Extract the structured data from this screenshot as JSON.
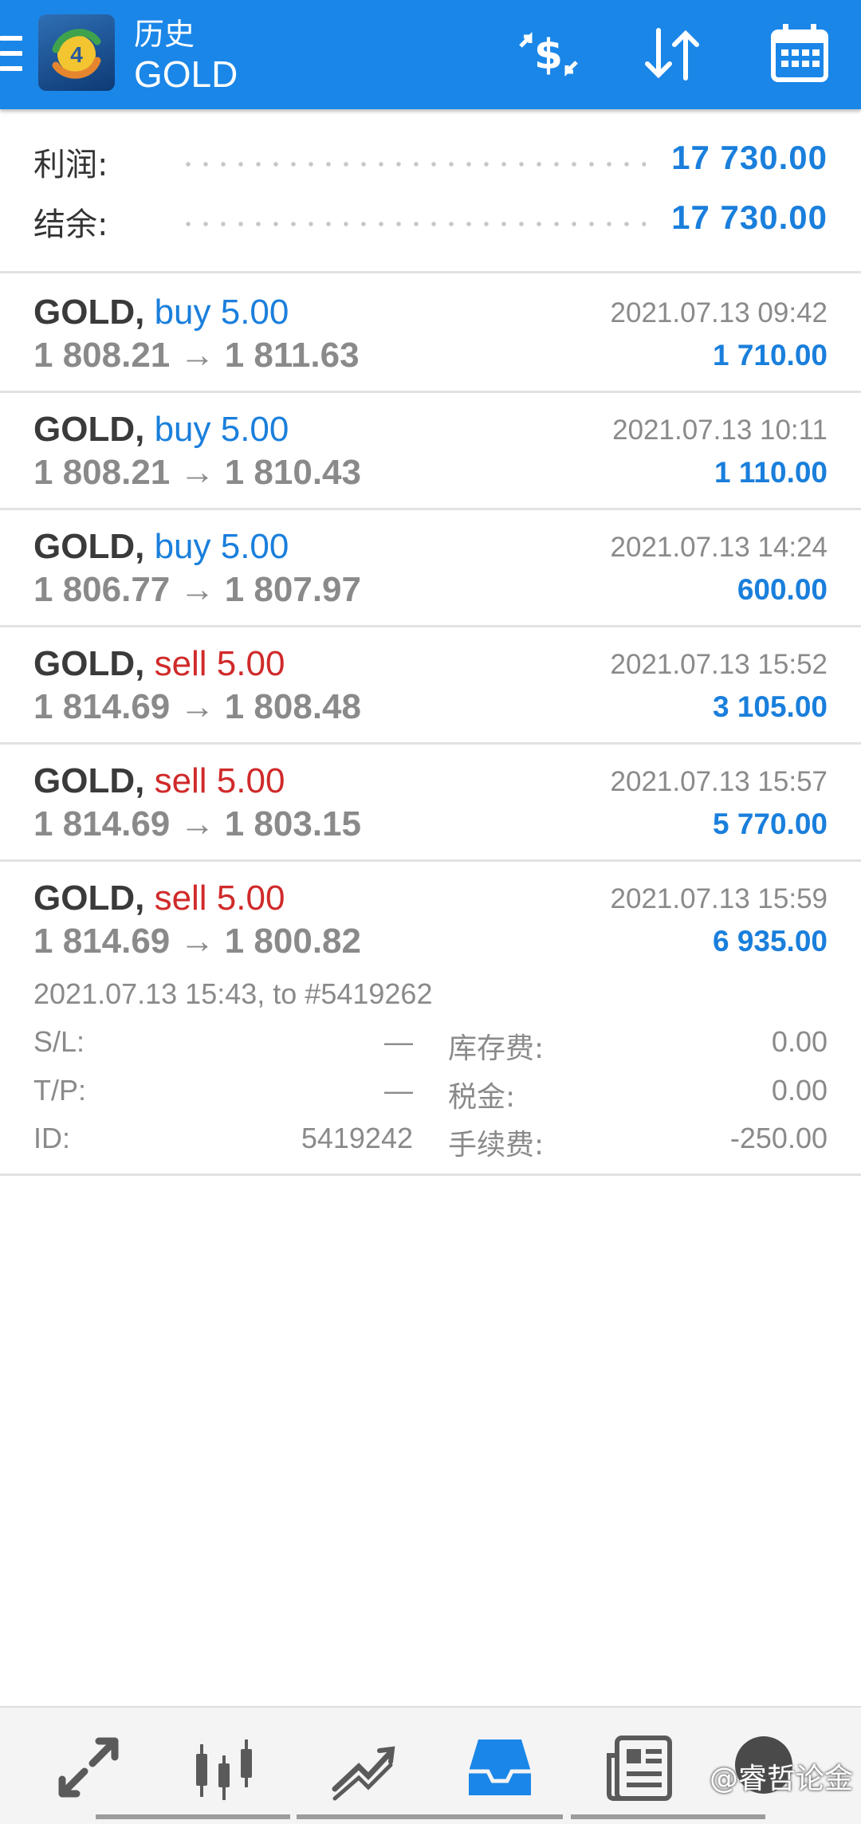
{
  "header": {
    "title": "历史",
    "subtitle": "GOLD",
    "icons": [
      "menu-icon",
      "metatrader-logo-icon",
      "currency-exchange-icon",
      "sort-icon",
      "calendar-icon"
    ]
  },
  "summary": {
    "profit_label": "利润:",
    "profit_value": "17 730.00",
    "balance_label": "结余:",
    "balance_value": "17 730.00"
  },
  "deals": [
    {
      "symbol": "GOLD,",
      "type": "buy 5.00",
      "direction": "buy",
      "prices": "1 808.21 → 1 811.63",
      "time": "2021.07.13 09:42",
      "profit": "1 710.00"
    },
    {
      "symbol": "GOLD,",
      "type": "buy 5.00",
      "direction": "buy",
      "prices": "1 808.21 → 1 810.43",
      "time": "2021.07.13 10:11",
      "profit": "1 110.00"
    },
    {
      "symbol": "GOLD,",
      "type": "buy 5.00",
      "direction": "buy",
      "prices": "1 806.77 → 1 807.97",
      "time": "2021.07.13 14:24",
      "profit": "600.00"
    },
    {
      "symbol": "GOLD,",
      "type": "sell 5.00",
      "direction": "sell",
      "prices": "1 814.69 → 1 808.48",
      "time": "2021.07.13 15:52",
      "profit": "3 105.00"
    },
    {
      "symbol": "GOLD,",
      "type": "sell 5.00",
      "direction": "sell",
      "prices": "1 814.69 → 1 803.15",
      "time": "2021.07.13 15:57",
      "profit": "5 770.00"
    },
    {
      "symbol": "GOLD,",
      "type": "sell 5.00",
      "direction": "sell",
      "prices": "1 814.69 → 1 800.82",
      "time": "2021.07.13 15:59",
      "profit": "6 935.00"
    }
  ],
  "detail": {
    "open_info": "2021.07.13 15:43, to #5419262",
    "sl_label": "S/L:",
    "sl_value": "—",
    "tp_label": "T/P:",
    "tp_value": "—",
    "id_label": "ID:",
    "id_value": "5419242",
    "swap_label": "库存费:",
    "swap_value": "0.00",
    "tax_label": "税金:",
    "tax_value": "0.00",
    "fee_label": "手续费:",
    "fee_value": "-250.00"
  },
  "bottom_nav": {
    "items": [
      "quotes-icon",
      "chart-icon",
      "trade-icon",
      "history-icon",
      "news-icon",
      "chat-icon"
    ],
    "active": "history-icon",
    "watermark": "@睿哲论金"
  },
  "colors": {
    "header_bg": "#1a86e8",
    "buy": "#1a7fdc",
    "sell": "#d02a2a",
    "profit": "#1a7fdc",
    "active_nav": "#1a86e8"
  }
}
